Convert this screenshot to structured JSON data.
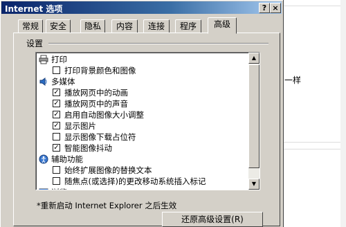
{
  "dialog": {
    "title": "Internet 选项",
    "help_label": "?",
    "close_label": "×"
  },
  "tabs": [
    {
      "label": "常规"
    },
    {
      "label": "安全"
    },
    {
      "label": "隐私"
    },
    {
      "label": "内容"
    },
    {
      "label": "连接"
    },
    {
      "label": "程序"
    },
    {
      "label": "高级",
      "active": true
    }
  ],
  "settings": {
    "group_label": "设置",
    "items": [
      {
        "type": "category",
        "icon": "printer-icon",
        "label": "打印"
      },
      {
        "type": "option",
        "label": "打印背景颜色和图像",
        "checked": false
      },
      {
        "type": "category",
        "icon": "multimedia-icon",
        "label": "多媒体"
      },
      {
        "type": "option",
        "label": "播放网页中的动画",
        "checked": true
      },
      {
        "type": "option",
        "label": "播放网页中的声音",
        "checked": true
      },
      {
        "type": "option",
        "label": "启用自动图像大小调整",
        "checked": true
      },
      {
        "type": "option",
        "label": "显示图片",
        "checked": true
      },
      {
        "type": "option",
        "label": "显示图像下载占位符",
        "checked": false
      },
      {
        "type": "option",
        "label": "智能图像抖动",
        "checked": true
      },
      {
        "type": "category",
        "icon": "accessibility-icon",
        "label": "辅助功能"
      },
      {
        "type": "option",
        "label": "始终扩展图像的替换文本",
        "checked": false
      },
      {
        "type": "option",
        "label": "随焦点(或选择)的更改移动系统插入标记",
        "checked": false
      },
      {
        "type": "category",
        "icon": "browse-icon",
        "label": "浏览"
      }
    ]
  },
  "note": "*重新启动 Internet Explorer 之后生效",
  "reset_button_label": "还原高级设置(R)",
  "background": {
    "partial_text": "一样"
  }
}
